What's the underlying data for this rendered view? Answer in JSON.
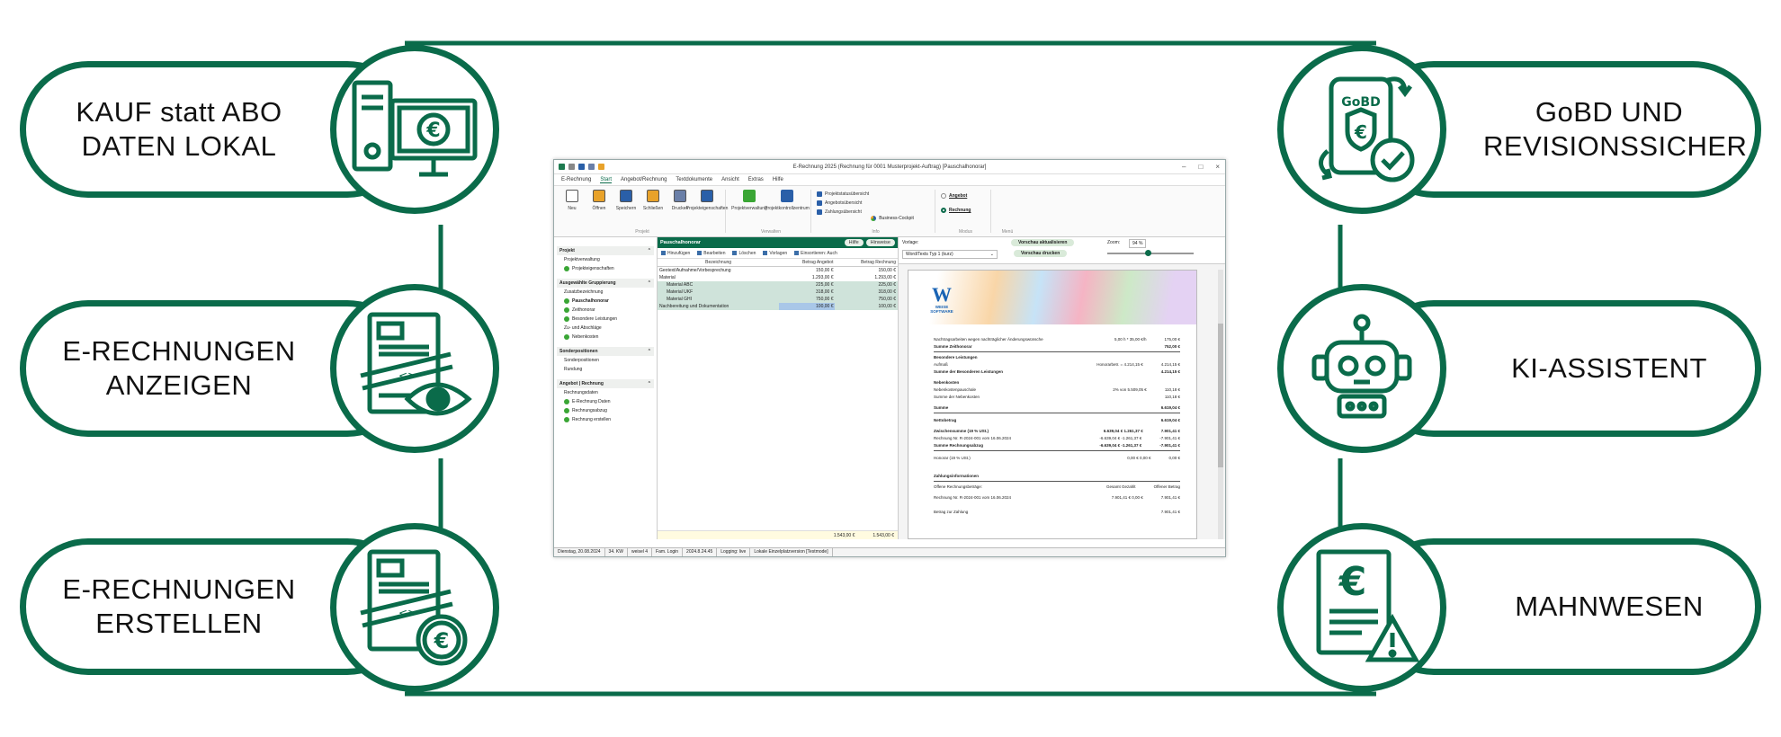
{
  "features": {
    "left": [
      {
        "line1": "KAUF statt ABO",
        "line2": "DATEN LOKAL"
      },
      {
        "line1": "E-RECHNUNGEN",
        "line2": "ANZEIGEN"
      },
      {
        "line1": "E-RECHNUNGEN",
        "line2": "ERSTELLEN"
      }
    ],
    "right": [
      {
        "line1": "GoBD UND",
        "line2": "REVISIONSSICHER"
      },
      {
        "line1": "KI-ASSISTENT",
        "line2": ""
      },
      {
        "line1": "MAHNWESEN",
        "line2": ""
      }
    ],
    "gobd_badge": "GoBD"
  },
  "colors": {
    "brand": "#0a6b4a",
    "accent": "#3aa635"
  },
  "app": {
    "title": "E-Rechnung 2025 (Rechnung für 0001 Musterprojekt-Auftrag) [Pauschalhonorar]",
    "menu": [
      "E-Rechnung",
      "Start",
      "Angebot/Rechnung",
      "Textdokumente",
      "Ansicht",
      "Extras",
      "Hilfe"
    ],
    "ribbon": {
      "projekt_buttons": [
        "Neu",
        "Öffnen",
        "Speichern",
        "Schließen",
        "Drucken",
        "Projekteigenschaften"
      ],
      "projekt_label": "Projekt",
      "verwalten_buttons": [
        "Projektverwaltung",
        "Projektkontrollzentrum"
      ],
      "verwalten_label": "Verwalten",
      "info_items": [
        "Projektstatusübersicht",
        "Angebotsübersicht",
        "Zahlungsübersicht"
      ],
      "business_cockpit": "Business-Cockpit",
      "info_label": "Info",
      "modus": [
        "Angebot",
        "Rechnung"
      ],
      "modus_label": "Modus",
      "menu_label": "Menü"
    },
    "sidebar": {
      "sections": [
        {
          "title": "Projekt",
          "items": [
            {
              "label": "Projektverwaltung",
              "check": false
            },
            {
              "label": "Projekteigenschaften",
              "check": true
            }
          ]
        },
        {
          "title": "Ausgewählte Gruppierung",
          "items": [
            {
              "label": "Zusatzbezeichnung",
              "check": false
            },
            {
              "label": "Pauschalhonorar",
              "check": true,
              "bold": true
            },
            {
              "label": "Zeithonorar",
              "check": true
            },
            {
              "label": "Besondere Leistungen",
              "check": true
            },
            {
              "label": "Zu- und Abschläge",
              "check": false
            },
            {
              "label": "Nebenkosten",
              "check": true
            }
          ]
        },
        {
          "title": "Sonderpositionen",
          "items": [
            {
              "label": "Sonderpositionen",
              "check": false
            },
            {
              "label": "Rundung",
              "check": false
            }
          ]
        },
        {
          "title": "Angebot | Rechnung",
          "items": [
            {
              "label": "Rechnungsdaten",
              "check": false
            },
            {
              "label": "E-Rechnung Daten",
              "check": true
            },
            {
              "label": "Rechnungsabzug",
              "check": true
            },
            {
              "label": "Rechnung erstellen",
              "check": true
            }
          ]
        }
      ]
    },
    "middle": {
      "title": "Pauschalhonorar",
      "help": "Hilfe",
      "hinweise": "Hinweise",
      "tools": [
        "Hinzufügen",
        "Bearbeiten",
        "Löschen",
        "Vorlagen",
        "Einsortieren: Auch"
      ],
      "columns": [
        "Bezeichnung",
        "Betrag Angebot",
        "Betrag Rechnung"
      ],
      "rows": [
        {
          "name": "Geotext/Aufnahme/Vorbesprechung",
          "a": "150,00 €",
          "r": "150,00 €"
        },
        {
          "name": "Material",
          "a": "1.293,00 €",
          "r": "1.293,00 €"
        },
        {
          "name": "Material ABC",
          "a": "225,00 €",
          "r": "225,00 €"
        },
        {
          "name": "Material UKF",
          "a": "318,00 €",
          "r": "318,00 €"
        },
        {
          "name": "Material GHI",
          "a": "750,00 €",
          "r": "750,00 €"
        },
        {
          "name": "Nachbereitung und Dokumentation",
          "a": "100,00 €",
          "r": "100,00 €"
        }
      ],
      "total_a": "1.543,00 €",
      "total_r": "1.543,00 €"
    },
    "preview": {
      "vorlage_label": "Vorlage:",
      "vorlage_value": "Word/Texts Typ 1 (kurz)",
      "update_btn": "Vorschau aktualisieren",
      "print_btn": "Vorschau drucken",
      "zoom_label": "Zoom:",
      "zoom_value": "94 %",
      "logo_text": "WEISE SOFTWARE",
      "lines": [
        {
          "t": "Nachtragsarbeiten wegen nachträglicher Änderungswünsche",
          "m": "5,00 h * 35,00 €/h",
          "v": "175,00 €",
          "b": false
        },
        {
          "t": "Summe Zeithonorar",
          "m": "",
          "v": "752,00 €",
          "b": true
        },
        {
          "t": "Besondere Leistungen",
          "m": "",
          "v": "",
          "b": true
        },
        {
          "t": "Aufmaß",
          "m": "Honorarbetr. = 4.214,15 €",
          "v": "4.214,15 €",
          "b": false
        },
        {
          "t": "Summe der Besonderen Leistungen",
          "m": "",
          "v": "4.214,15 €",
          "b": true
        },
        {
          "t": "Nebenkosten",
          "m": "",
          "v": "",
          "b": true
        },
        {
          "t": "Nebenkostenpauschale",
          "m": "2% von 5.509,05 €",
          "v": "110,18 €",
          "b": false
        },
        {
          "t": "Summe der Nebenkosten",
          "m": "",
          "v": "110,18 €",
          "b": false
        },
        {
          "t": "Summe",
          "m": "",
          "v": "6.619,04 €",
          "b": true
        },
        {
          "t": "Nettobetrag",
          "m": "",
          "v": "6.619,04 €",
          "b": true
        },
        {
          "t": "Zwischensumme (19 % USt.)",
          "m": "6.639,04 €    1.261,37 €",
          "v": "7.901,41 €",
          "b": true
        },
        {
          "t": "Rechnung Nr. R-2024-001 vom 16.06.2024",
          "m": "-6.639,04 €   -1.261,37 €",
          "v": "-7.901,41 €",
          "b": false
        },
        {
          "t": "Summe Rechnungsabzug",
          "m": "-6.639,04 €   -1.261,37 €",
          "v": "-7.901,41 €",
          "b": true
        },
        {
          "t": "Honorar (19 % USt.)",
          "m": "0,00 €     0,00 €",
          "v": "0,00 €",
          "b": false
        },
        {
          "t": "Zahlungsinformationen",
          "m": "",
          "v": "",
          "b": true
        },
        {
          "t": "Offene Rechnungsbeträge:",
          "m": "Gesamt   Gezahlt",
          "v": "Offener Betrag",
          "b": false
        },
        {
          "t": "Rechnung Nr. R-2024-001 vom 16.06.2024",
          "m": "7.901,41 €   0,00 €",
          "v": "7.901,41 €",
          "b": false
        },
        {
          "t": "Betrag zur Zahlung",
          "m": "",
          "v": "7.901,41 €",
          "b": false
        }
      ]
    },
    "statusbar": [
      "Dienstag, 20.08.2024",
      "34. KW",
      "weisel 4",
      "Fam. Login",
      "2024.8.24.45",
      "Logging: live",
      "Lokale Einzelplatzversion [Testmode]"
    ]
  }
}
